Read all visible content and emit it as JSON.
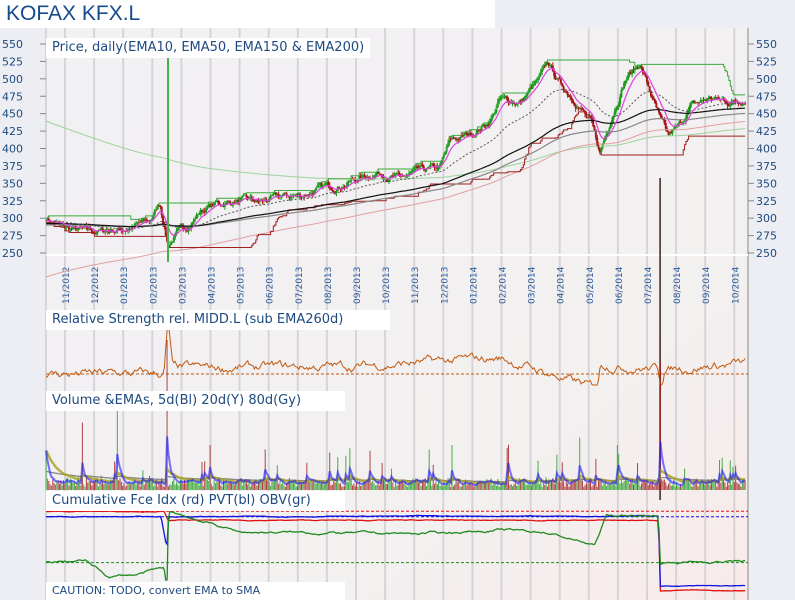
{
  "header": {
    "title": "KOFAX KFX.L"
  },
  "panels": {
    "price": "Price, daily(EMA10, EMA50, EMA150 & EMA200)",
    "rs": "Relative Strength rel. MIDD.L (sub EMA260d)",
    "volume": "Volume &EMAs, 5d(Bl) 20d(Y) 80d(Gy)",
    "cumulative": "Cumulative Fce Idx (rd) PVT(bl) OBV(gr)",
    "caution": "CAUTION: TODO, convert EMA to SMA"
  },
  "colors": {
    "up": "#1a9a1a",
    "down": "#a01818",
    "ema10": "#e040e0",
    "ema50": "#555555",
    "ema150": "#111111",
    "ema200": "#888888",
    "upper": "#3aaa3a",
    "lower": "#a02020",
    "rs": "#c05a10",
    "blue": "#1a1aff",
    "yellow": "#a8a020"
  },
  "chart_data": {
    "type": "line",
    "title": "KOFAX KFX.L",
    "x_unit": "months since 11/2012",
    "xtick_labels": [
      "11/2012",
      "12/2012",
      "01/2013",
      "02/2013",
      "03/2013",
      "04/2013",
      "05/2013",
      "06/2013",
      "07/2013",
      "08/2013",
      "09/2013",
      "10/2013",
      "11/2013",
      "12/2013",
      "01/2014",
      "02/2014",
      "03/2014",
      "04/2014",
      "05/2014",
      "06/2014",
      "07/2014",
      "08/2014",
      "09/2014",
      "10/2014"
    ],
    "yticks": [
      550,
      525,
      500,
      475,
      450,
      425,
      400,
      375,
      350,
      325,
      300,
      275,
      250
    ],
    "ylim": [
      250,
      550
    ],
    "price_anchors": [
      [
        -0.65,
        300
      ],
      [
        0,
        285
      ],
      [
        1.03,
        280
      ],
      [
        2.06,
        285
      ],
      [
        2.92,
        295
      ],
      [
        3.26,
        322
      ],
      [
        3.54,
        262
      ],
      [
        3.78,
        275
      ],
      [
        4.3,
        292
      ],
      [
        4.64,
        310
      ],
      [
        5.15,
        320
      ],
      [
        6.01,
        325
      ],
      [
        6.7,
        322
      ],
      [
        7.39,
        330
      ],
      [
        8.08,
        332
      ],
      [
        8.76,
        342
      ],
      [
        9.45,
        348
      ],
      [
        10.14,
        358
      ],
      [
        10.82,
        366
      ],
      [
        11.51,
        356
      ],
      [
        12.2,
        366
      ],
      [
        12.89,
        372
      ],
      [
        13.23,
        410
      ],
      [
        13.92,
        420
      ],
      [
        14.6,
        440
      ],
      [
        14.95,
        470
      ],
      [
        15.64,
        466
      ],
      [
        16.32,
        500
      ],
      [
        16.6,
        522
      ],
      [
        17.01,
        492
      ],
      [
        17.53,
        470
      ],
      [
        18.04,
        440
      ],
      [
        18.38,
        392
      ],
      [
        18.73,
        440
      ],
      [
        19.24,
        500
      ],
      [
        19.76,
        522
      ],
      [
        20.1,
        482
      ],
      [
        20.45,
        440
      ],
      [
        20.72,
        415
      ],
      [
        21.13,
        432
      ],
      [
        21.48,
        460
      ],
      [
        22.16,
        472
      ],
      [
        22.85,
        466
      ],
      [
        23.37,
        472
      ]
    ],
    "events": [
      {
        "t": 3.54,
        "type": "volume-spike"
      },
      {
        "t": 20.45,
        "type": "gap-down"
      }
    ],
    "relative_strength_anchors": [
      [
        -0.65,
        0
      ],
      [
        3.4,
        0
      ],
      [
        3.54,
        20
      ],
      [
        3.7,
        2
      ],
      [
        10,
        3
      ],
      [
        15,
        6
      ],
      [
        18.3,
        -6
      ],
      [
        18.4,
        4
      ],
      [
        20.4,
        2
      ],
      [
        20.45,
        -6
      ],
      [
        20.6,
        2
      ],
      [
        23.37,
        4
      ]
    ],
    "volume_spikes": [
      [
        0.6,
        45
      ],
      [
        1.8,
        55
      ],
      [
        3.5,
        100
      ],
      [
        5,
        30
      ],
      [
        9.1,
        25
      ],
      [
        13.3,
        30
      ],
      [
        17.7,
        35
      ],
      [
        19,
        30
      ],
      [
        20.45,
        85
      ],
      [
        22.5,
        20
      ]
    ],
    "cumulative": {
      "force_index": [
        [
          -0.65,
          93
        ],
        [
          3.4,
          93
        ],
        [
          3.54,
          83
        ],
        [
          20.4,
          83
        ],
        [
          20.45,
          5
        ],
        [
          23.37,
          5
        ]
      ],
      "pvt": [
        [
          -0.65,
          87
        ],
        [
          3.3,
          87
        ],
        [
          3.5,
          52
        ],
        [
          3.56,
          87
        ],
        [
          20.4,
          88
        ],
        [
          20.45,
          10
        ],
        [
          23.37,
          10
        ]
      ],
      "obv": [
        [
          -0.65,
          36
        ],
        [
          0.7,
          38
        ],
        [
          1.5,
          20
        ],
        [
          2.5,
          23
        ],
        [
          3.4,
          30
        ],
        [
          3.5,
          5
        ],
        [
          3.56,
          93
        ],
        [
          6,
          70
        ],
        [
          12,
          68
        ],
        [
          15,
          72
        ],
        [
          16.5,
          70
        ],
        [
          18.2,
          55
        ],
        [
          18.6,
          88
        ],
        [
          20.4,
          88
        ],
        [
          20.45,
          36
        ],
        [
          23.37,
          38
        ]
      ],
      "levels": {
        "force_index": 93,
        "pvt": 87,
        "obv": 36
      }
    }
  }
}
